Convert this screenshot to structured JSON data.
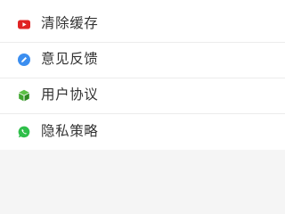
{
  "menu": {
    "items": [
      {
        "label": "清除缓存",
        "icon": "youtube-icon",
        "icon_color": "#e02424"
      },
      {
        "label": "意见反馈",
        "icon": "feedback-icon",
        "icon_color": "#3b8ef0"
      },
      {
        "label": "用户协议",
        "icon": "cube-icon",
        "icon_color": "#3fa62e"
      },
      {
        "label": "隐私策略",
        "icon": "whatsapp-icon",
        "icon_color": "#2fbf4a"
      }
    ]
  }
}
